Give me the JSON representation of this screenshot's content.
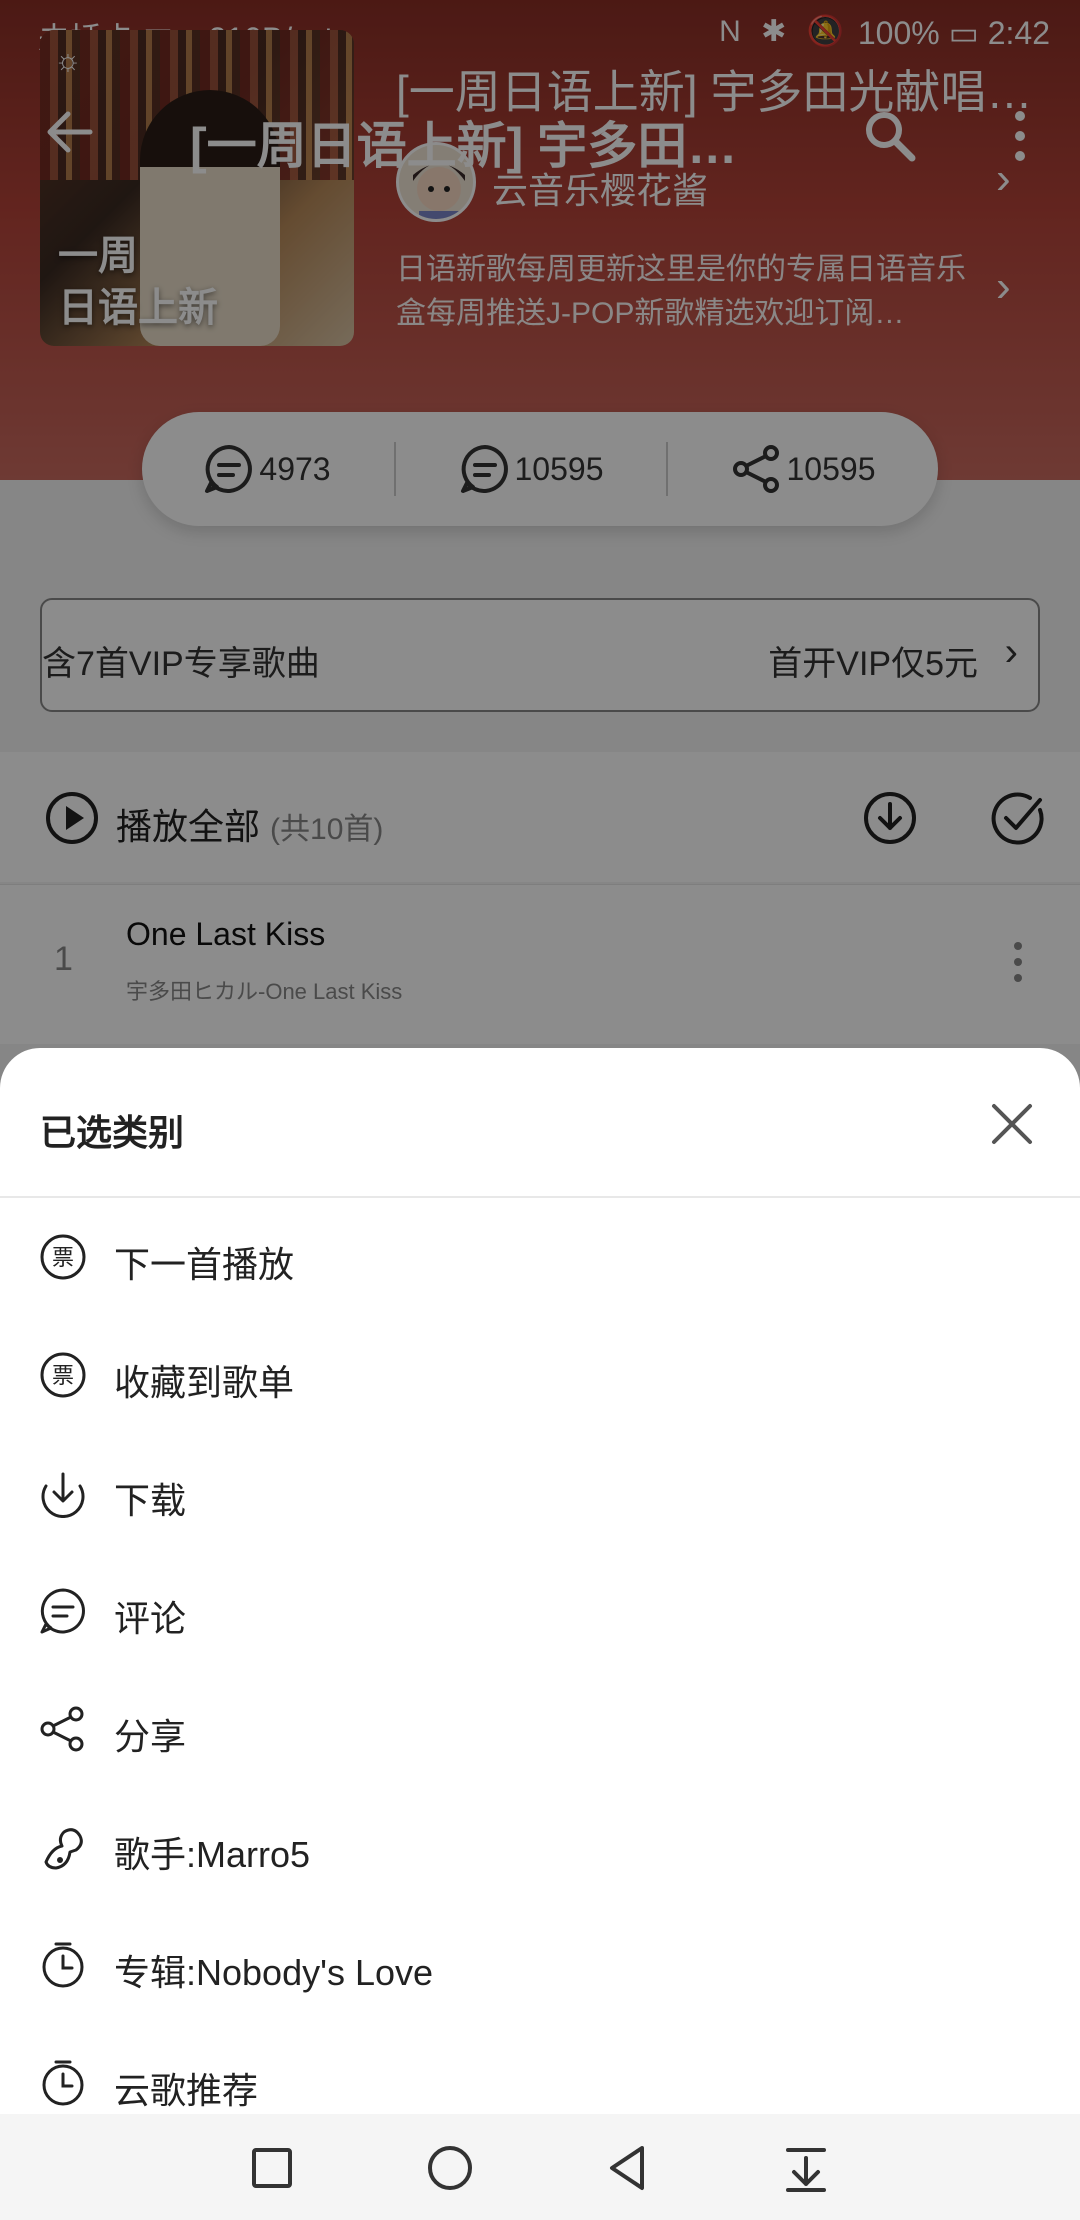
{
  "status_bar": {
    "carrier": "未插卡",
    "speed": "210B/s",
    "battery": "100%",
    "time": "2:42"
  },
  "header": {
    "title": "[一周日语上新] 宇多田…",
    "back_icon": "back-arrow-icon",
    "search_icon": "search-icon",
    "more_icon": "more-vertical-icon"
  },
  "playlist": {
    "cover_text_line1": "一周",
    "cover_text_line2": "日语上新",
    "title": "[一周日语上新] 宇多田光献唱…",
    "creator": "云音乐樱花酱",
    "description": "日语新歌每周更新这里是你的专属日语音乐盒每周推送J-POP新歌精选欢迎订阅…"
  },
  "stats": {
    "comments": "4973",
    "messages": "10595",
    "shares": "10595"
  },
  "vip": {
    "left": "含7首VIP专享歌曲",
    "right": "首开VIP仅5元"
  },
  "list": {
    "play_all": "播放全部",
    "count": "(共10首)"
  },
  "song": {
    "index": "1",
    "name": "One Last Kiss",
    "sub": "宇多田ヒカル-One Last Kiss"
  },
  "sheet": {
    "title": "已选类别",
    "options": [
      {
        "label": "下一首播放",
        "icon": "ticket-icon"
      },
      {
        "label": "收藏到歌单",
        "icon": "ticket-icon"
      },
      {
        "label": "下载",
        "icon": "download-icon"
      },
      {
        "label": "评论",
        "icon": "comment-icon"
      },
      {
        "label": "分享",
        "icon": "share-icon"
      },
      {
        "label": "歌手:Marro5",
        "icon": "singer-icon"
      },
      {
        "label": "专辑:Nobody's Love",
        "icon": "clock-icon"
      },
      {
        "label": "云歌推荐",
        "icon": "clock-icon"
      }
    ]
  },
  "colors": {
    "hero": "#b5443a",
    "sheet_bg": "#ffffff",
    "text": "#222222"
  }
}
